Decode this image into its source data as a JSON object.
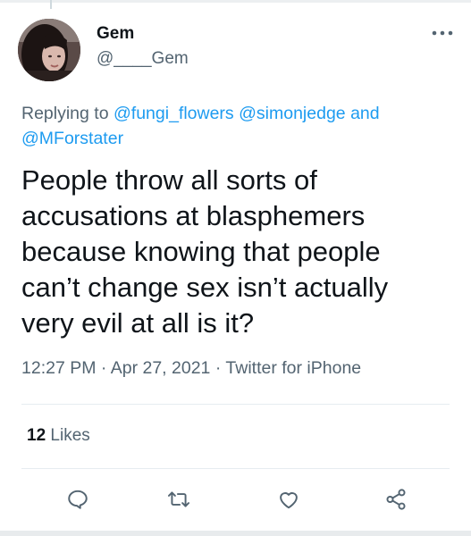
{
  "tweet": {
    "display_name": "Gem",
    "handle": "@____Gem",
    "replying_prefix": "Replying to",
    "replying_to": [
      "@fungi_flowers",
      "@simonjedge",
      "@MForstater"
    ],
    "replying_and": "and",
    "text": "People throw all sorts of\naccusations at blasphemers\nbecause knowing that people\ncan’t change sex isn’t actually\nvery evil at all is it?",
    "time": "12:27 PM",
    "date": "Apr 27, 2021",
    "source": "Twitter for iPhone",
    "separator": "·",
    "likes_count": "12",
    "likes_label": "Likes"
  },
  "colors": {
    "link": "#1d9bf0",
    "secondary_text": "#536471",
    "primary_text": "#0f1419"
  },
  "icons": [
    "more-horizontal-icon",
    "reply-icon",
    "retweet-icon",
    "like-icon",
    "share-icon"
  ]
}
